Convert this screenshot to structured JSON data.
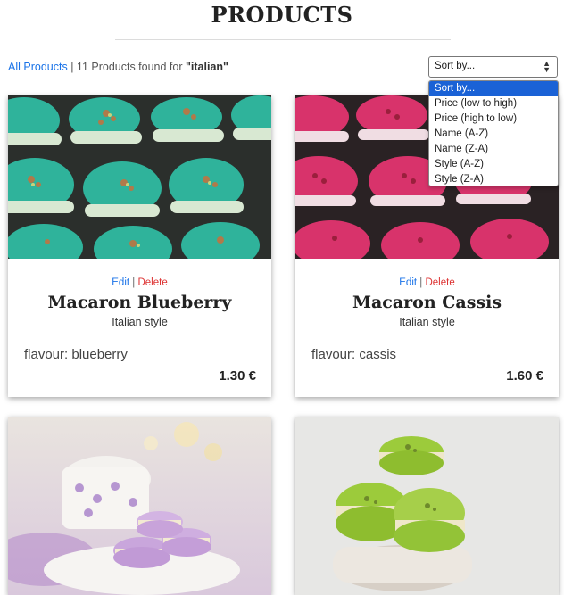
{
  "page": {
    "title": "PRODUCTS"
  },
  "results": {
    "all_products_link": "All Products",
    "separator": "|",
    "count_text": "11 Products found for",
    "query": "\"italian\""
  },
  "sort": {
    "selected": "Sort by...",
    "options": [
      "Sort by...",
      "Price (low to high)",
      "Price (high to low)",
      "Name (A-Z)",
      "Name (Z-A)",
      "Style (A-Z)",
      "Style (Z-A)"
    ]
  },
  "products": [
    {
      "edit": "Edit",
      "sep": "|",
      "delete": "Delete",
      "name": "Macaron Blueberry",
      "style": "Italian style",
      "flavour": "flavour: blueberry",
      "price": "1.30 €"
    },
    {
      "edit": "Edit",
      "sep": "|",
      "delete": "Delete",
      "name": "Macaron Cassis",
      "style": "Italian style",
      "flavour": "flavour: cassis",
      "price": "1.60 €"
    }
  ],
  "colors": {
    "link": "#1a73e8",
    "delete": "#dd3333",
    "dropdown_highlight": "#1a62d6",
    "blueberry_macaron": "#2fb39b",
    "cassis_macaron": "#d8336b",
    "lavender_macaron": "#c9a6dc",
    "pistachio_macaron": "#9ccb3b"
  }
}
